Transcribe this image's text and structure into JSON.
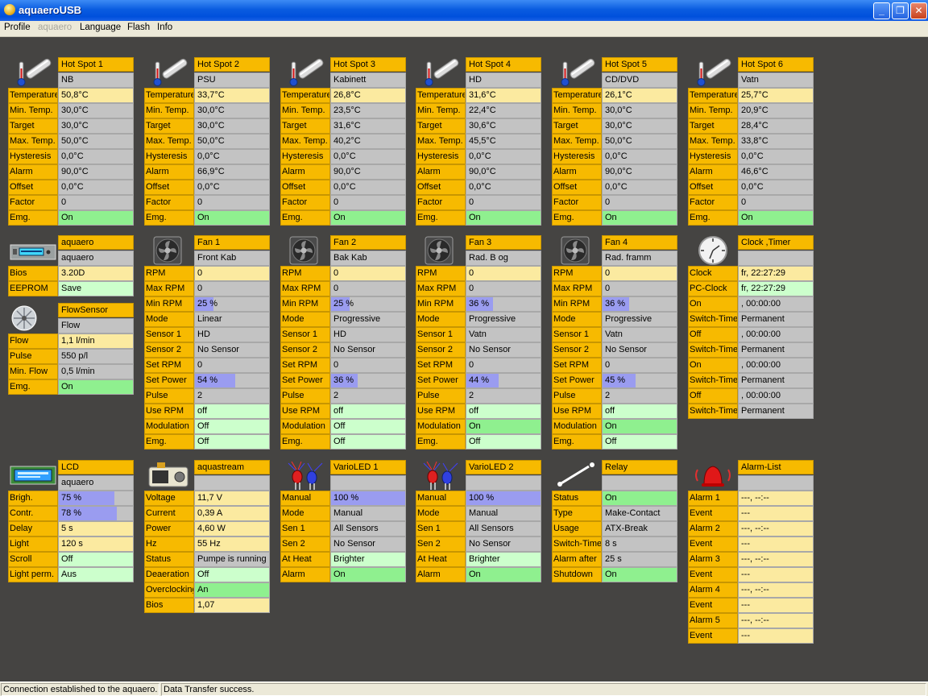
{
  "window": {
    "title": "aquaeroUSB"
  },
  "menu": [
    "Profile",
    "aquaero",
    "Language",
    "Flash",
    "Info"
  ],
  "status": {
    "left": "Connection established to the aquaero.",
    "right": "Data Transfer success."
  },
  "colors": {
    "label": "#f7ba00",
    "value_gray": "#c3c3c3",
    "value_yellow": "#fbeaa0",
    "value_lightgreen": "#ccffcc",
    "value_green": "#8ff08f",
    "bar_blue": "#9a9cf0",
    "background": "#454442"
  },
  "panels": [
    {
      "id": "hotspot1",
      "icon": "thermometer-icon",
      "title": "Hot Spot 1",
      "subtitle": "NB",
      "rows": [
        [
          "Temperature",
          "50,8°C",
          "y"
        ],
        [
          "Min. Temp.",
          "30,0°C",
          "g"
        ],
        [
          "Target",
          "30,0°C",
          "g"
        ],
        [
          "Max. Temp.",
          "50,0°C",
          "g"
        ],
        [
          "Hysteresis",
          "0,0°C",
          "g"
        ],
        [
          "Alarm",
          "90,0°C",
          "g"
        ],
        [
          "Offset",
          "0,0°C",
          "g"
        ],
        [
          "Factor",
          "0",
          "g"
        ],
        [
          "Emg.",
          "On",
          "G"
        ]
      ]
    },
    {
      "id": "hotspot2",
      "icon": "thermometer-icon",
      "title": "Hot Spot 2",
      "subtitle": "PSU",
      "rows": [
        [
          "Temperature",
          "33,7°C",
          "y"
        ],
        [
          "Min. Temp.",
          "30,0°C",
          "g"
        ],
        [
          "Target",
          "30,0°C",
          "g"
        ],
        [
          "Max. Temp.",
          "50,0°C",
          "g"
        ],
        [
          "Hysteresis",
          "0,0°C",
          "g"
        ],
        [
          "Alarm",
          "66,9°C",
          "g"
        ],
        [
          "Offset",
          "0,0°C",
          "g"
        ],
        [
          "Factor",
          "0",
          "g"
        ],
        [
          "Emg.",
          "On",
          "G"
        ]
      ]
    },
    {
      "id": "hotspot3",
      "icon": "thermometer-icon",
      "title": "Hot Spot 3",
      "subtitle": "Kabinett",
      "rows": [
        [
          "Temperature",
          "26,8°C",
          "y"
        ],
        [
          "Min. Temp.",
          "23,5°C",
          "g"
        ],
        [
          "Target",
          "31,6°C",
          "g"
        ],
        [
          "Max. Temp.",
          "40,2°C",
          "g"
        ],
        [
          "Hysteresis",
          "0,0°C",
          "g"
        ],
        [
          "Alarm",
          "90,0°C",
          "g"
        ],
        [
          "Offset",
          "0,0°C",
          "g"
        ],
        [
          "Factor",
          "0",
          "g"
        ],
        [
          "Emg.",
          "On",
          "G"
        ]
      ]
    },
    {
      "id": "hotspot4",
      "icon": "thermometer-icon",
      "title": "Hot Spot 4",
      "subtitle": "HD",
      "rows": [
        [
          "Temperature",
          "31,6°C",
          "y"
        ],
        [
          "Min. Temp.",
          "22,4°C",
          "g"
        ],
        [
          "Target",
          "30,6°C",
          "g"
        ],
        [
          "Max. Temp.",
          "45,5°C",
          "g"
        ],
        [
          "Hysteresis",
          "0,0°C",
          "g"
        ],
        [
          "Alarm",
          "90,0°C",
          "g"
        ],
        [
          "Offset",
          "0,0°C",
          "g"
        ],
        [
          "Factor",
          "0",
          "g"
        ],
        [
          "Emg.",
          "On",
          "G"
        ]
      ]
    },
    {
      "id": "hotspot5",
      "icon": "thermometer-icon",
      "title": "Hot Spot 5",
      "subtitle": "CD/DVD",
      "rows": [
        [
          "Temperature",
          "26,1°C",
          "y"
        ],
        [
          "Min. Temp.",
          "30,0°C",
          "g"
        ],
        [
          "Target",
          "30,0°C",
          "g"
        ],
        [
          "Max. Temp.",
          "50,0°C",
          "g"
        ],
        [
          "Hysteresis",
          "0,0°C",
          "g"
        ],
        [
          "Alarm",
          "90,0°C",
          "g"
        ],
        [
          "Offset",
          "0,0°C",
          "g"
        ],
        [
          "Factor",
          "0",
          "g"
        ],
        [
          "Emg.",
          "On",
          "G"
        ]
      ]
    },
    {
      "id": "hotspot6",
      "icon": "thermometer-icon",
      "title": "Hot Spot 6",
      "subtitle": "Vatn",
      "rows": [
        [
          "Temperature",
          "25,7°C",
          "y"
        ],
        [
          "Min. Temp.",
          "20,9°C",
          "g"
        ],
        [
          "Target",
          "28,4°C",
          "g"
        ],
        [
          "Max. Temp.",
          "33,8°C",
          "g"
        ],
        [
          "Hysteresis",
          "0,0°C",
          "g"
        ],
        [
          "Alarm",
          "46,6°C",
          "g"
        ],
        [
          "Offset",
          "0,0°C",
          "g"
        ],
        [
          "Factor",
          "0",
          "g"
        ],
        [
          "Emg.",
          "On",
          "G"
        ]
      ]
    },
    {
      "id": "aquaero",
      "icon": "aquaero-device-icon",
      "title": "aquaero",
      "subtitle": "aquaero",
      "rows": [
        [
          "Bios",
          "3.20D",
          "y"
        ],
        [
          "EEPROM",
          "Save",
          "l"
        ]
      ]
    },
    {
      "id": "flowsensor",
      "icon": "flow-sensor-icon",
      "title": "FlowSensor",
      "subtitle": "Flow",
      "rows": [
        [
          "Flow",
          "1,1 l/min",
          "y"
        ],
        [
          "Pulse",
          "550 p/l",
          "g"
        ],
        [
          "Min. Flow",
          "0,5 l/min",
          "g"
        ],
        [
          "Emg.",
          "On",
          "G"
        ]
      ]
    },
    {
      "id": "fan1",
      "icon": "fan-icon",
      "title": "Fan 1",
      "subtitle": "Front Kab",
      "rows": [
        [
          "RPM",
          "0",
          "y"
        ],
        [
          "Max RPM",
          "0",
          "g"
        ],
        [
          "Min RPM",
          "25 %",
          "b",
          25
        ],
        [
          "Mode",
          "Linear",
          "g"
        ],
        [
          "Sensor 1",
          "HD",
          "g"
        ],
        [
          "Sensor 2",
          "No Sensor",
          "g"
        ],
        [
          "Set RPM",
          "0",
          "g"
        ],
        [
          "Set Power",
          "54 %",
          "b",
          54
        ],
        [
          "Pulse",
          "2",
          "g"
        ],
        [
          "Use RPM",
          "off",
          "l"
        ],
        [
          "Modulation",
          "Off",
          "l"
        ],
        [
          "Emg.",
          "Off",
          "l"
        ]
      ]
    },
    {
      "id": "fan2",
      "icon": "fan-icon",
      "title": "Fan 2",
      "subtitle": "Bak Kab",
      "rows": [
        [
          "RPM",
          "0",
          "y"
        ],
        [
          "Max RPM",
          "0",
          "g"
        ],
        [
          "Min RPM",
          "25 %",
          "b",
          25
        ],
        [
          "Mode",
          "Progressive",
          "g"
        ],
        [
          "Sensor 1",
          "HD",
          "g"
        ],
        [
          "Sensor 2",
          "No Sensor",
          "g"
        ],
        [
          "Set RPM",
          "0",
          "g"
        ],
        [
          "Set Power",
          "36 %",
          "b",
          36
        ],
        [
          "Pulse",
          "2",
          "g"
        ],
        [
          "Use RPM",
          "off",
          "l"
        ],
        [
          "Modulation",
          "Off",
          "l"
        ],
        [
          "Emg.",
          "Off",
          "l"
        ]
      ]
    },
    {
      "id": "fan3",
      "icon": "fan-icon",
      "title": "Fan 3",
      "subtitle": "Rad. B og",
      "rows": [
        [
          "RPM",
          "0",
          "y"
        ],
        [
          "Max RPM",
          "0",
          "g"
        ],
        [
          "Min RPM",
          "36 %",
          "b",
          36
        ],
        [
          "Mode",
          "Progressive",
          "g"
        ],
        [
          "Sensor 1",
          "Vatn",
          "g"
        ],
        [
          "Sensor 2",
          "No Sensor",
          "g"
        ],
        [
          "Set RPM",
          "0",
          "g"
        ],
        [
          "Set Power",
          "44 %",
          "b",
          44
        ],
        [
          "Pulse",
          "2",
          "g"
        ],
        [
          "Use RPM",
          "off",
          "l"
        ],
        [
          "Modulation",
          "On",
          "G"
        ],
        [
          "Emg.",
          "Off",
          "l"
        ]
      ]
    },
    {
      "id": "fan4",
      "icon": "fan-icon",
      "title": "Fan 4",
      "subtitle": "Rad. framm",
      "rows": [
        [
          "RPM",
          "0",
          "y"
        ],
        [
          "Max RPM",
          "0",
          "g"
        ],
        [
          "Min RPM",
          "36 %",
          "b",
          36
        ],
        [
          "Mode",
          "Progressive",
          "g"
        ],
        [
          "Sensor 1",
          "Vatn",
          "g"
        ],
        [
          "Sensor 2",
          "No Sensor",
          "g"
        ],
        [
          "Set RPM",
          "0",
          "g"
        ],
        [
          "Set Power",
          "45 %",
          "b",
          45
        ],
        [
          "Pulse",
          "2",
          "g"
        ],
        [
          "Use RPM",
          "off",
          "l"
        ],
        [
          "Modulation",
          "On",
          "G"
        ],
        [
          "Emg.",
          "Off",
          "l"
        ]
      ]
    },
    {
      "id": "clock",
      "icon": "clock-icon",
      "title": "Clock ,Timer",
      "subtitle": "",
      "rows": [
        [
          "Clock",
          "fr, 22:27:29",
          "y"
        ],
        [
          "PC-Clock",
          "fr, 22:27:29",
          "l"
        ],
        [
          "On",
          ", 00:00:00",
          "g"
        ],
        [
          "Switch-Time",
          "Permanent",
          "g"
        ],
        [
          "Off",
          ", 00:00:00",
          "g"
        ],
        [
          "Switch-Time",
          "Permanent",
          "g"
        ],
        [
          "On",
          ", 00:00:00",
          "g"
        ],
        [
          "Switch-Time",
          "Permanent",
          "g"
        ],
        [
          "Off",
          ", 00:00:00",
          "g"
        ],
        [
          "Switch-Time",
          "Permanent",
          "g"
        ]
      ]
    },
    {
      "id": "lcd",
      "icon": "lcd-icon",
      "title": "LCD",
      "subtitle": "aquaero",
      "rows": [
        [
          "Brigh.",
          "75 %",
          "b",
          75
        ],
        [
          "Contr.",
          "78 %",
          "b",
          78
        ],
        [
          "Delay",
          "5 s",
          "y"
        ],
        [
          "Light",
          "120 s",
          "y"
        ],
        [
          "Scroll",
          "Off",
          "l"
        ],
        [
          "Light perm.",
          "Aus",
          "l"
        ]
      ]
    },
    {
      "id": "aquastream",
      "icon": "pump-icon",
      "title": "aquastream",
      "subtitle": "",
      "rows": [
        [
          "Voltage",
          "11,7 V",
          "y"
        ],
        [
          "Current",
          "0,39 A",
          "y"
        ],
        [
          "Power",
          "4,60 W",
          "y"
        ],
        [
          "Hz",
          "55 Hz",
          "y"
        ],
        [
          "Status",
          "Pumpe is running",
          "g"
        ],
        [
          "Deaeration",
          "Off",
          "l"
        ],
        [
          "Overclocking",
          "An",
          "G"
        ],
        [
          "Bios",
          "1,07",
          "y"
        ]
      ]
    },
    {
      "id": "varioled1",
      "icon": "led-icon",
      "title": "VarioLED 1",
      "subtitle": "",
      "rows": [
        [
          "Manual",
          "100 %",
          "b",
          100
        ],
        [
          "Mode",
          "Manual",
          "g"
        ],
        [
          "Sen 1",
          "All Sensors",
          "g"
        ],
        [
          "Sen 2",
          "No Sensor",
          "g"
        ],
        [
          "At Heat",
          "Brighter",
          "l"
        ],
        [
          "Alarm",
          "On",
          "G"
        ]
      ]
    },
    {
      "id": "varioled2",
      "icon": "led-icon",
      "title": "VarioLED 2",
      "subtitle": "",
      "rows": [
        [
          "Manual",
          "100 %",
          "b",
          100
        ],
        [
          "Mode",
          "Manual",
          "g"
        ],
        [
          "Sen 1",
          "All Sensors",
          "g"
        ],
        [
          "Sen 2",
          "No Sensor",
          "g"
        ],
        [
          "At Heat",
          "Brighter",
          "l"
        ],
        [
          "Alarm",
          "On",
          "G"
        ]
      ]
    },
    {
      "id": "relay",
      "icon": "relay-switch-icon",
      "title": "Relay",
      "subtitle": "",
      "rows": [
        [
          "Status",
          "On",
          "G"
        ],
        [
          "Type",
          "Make-Contact",
          "g"
        ],
        [
          "Usage",
          "ATX-Break",
          "g"
        ],
        [
          "Switch-Time",
          "8 s",
          "g"
        ],
        [
          "Alarm after",
          "25 s",
          "g"
        ],
        [
          "Shutdown",
          "On",
          "G"
        ]
      ]
    },
    {
      "id": "alarmlist",
      "icon": "alarm-bell-icon",
      "title": "Alarm-List",
      "subtitle": "",
      "rows": [
        [
          "Alarm 1",
          "---, --:--",
          "y"
        ],
        [
          "Event",
          "---",
          "y"
        ],
        [
          "Alarm 2",
          "---, --:--",
          "y"
        ],
        [
          "Event",
          "---",
          "y"
        ],
        [
          "Alarm 3",
          "---, --:--",
          "y"
        ],
        [
          "Event",
          "---",
          "y"
        ],
        [
          "Alarm 4",
          "---, --:--",
          "y"
        ],
        [
          "Event",
          "---",
          "y"
        ],
        [
          "Alarm 5",
          "---, --:--",
          "y"
        ],
        [
          "Event",
          "---",
          "y"
        ]
      ]
    }
  ]
}
